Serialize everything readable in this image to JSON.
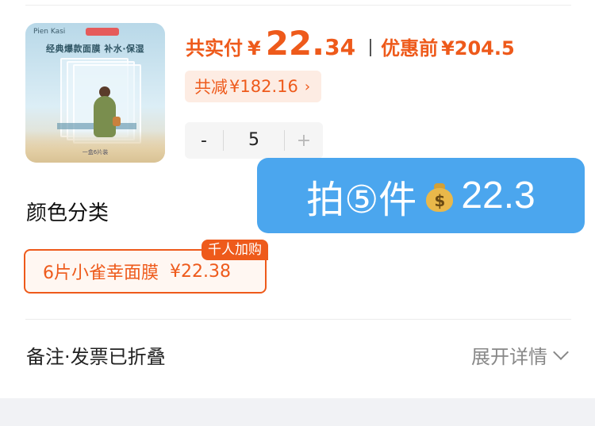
{
  "product": {
    "image_brand": "Pien Kasi",
    "image_caption": "经典爆款面膜 补水·保湿",
    "image_footer": "一盒6片装"
  },
  "price": {
    "paid_label": "共实付",
    "currency": "¥",
    "paid_integer": "22.",
    "paid_decimal": "34",
    "original_label": "优惠前",
    "original_value": "¥204.5"
  },
  "discount": {
    "label": "共减",
    "amount": "¥182.16",
    "chevron": "›"
  },
  "quantity": {
    "minus": "-",
    "value": "5",
    "plus": "+"
  },
  "promo_overlay": {
    "text": "拍⑤件",
    "dollar": "$",
    "amount": "22.3"
  },
  "color_section": {
    "title": "颜色分类",
    "options": [
      {
        "name": "6片小雀幸面膜",
        "price": "¥22.38",
        "tag": "千人加购"
      }
    ]
  },
  "remarks": {
    "label": "备注·发票已折叠",
    "expand": "展开详情"
  },
  "colors": {
    "accent": "#ee5a1b",
    "overlay": "#4ba6ee"
  }
}
